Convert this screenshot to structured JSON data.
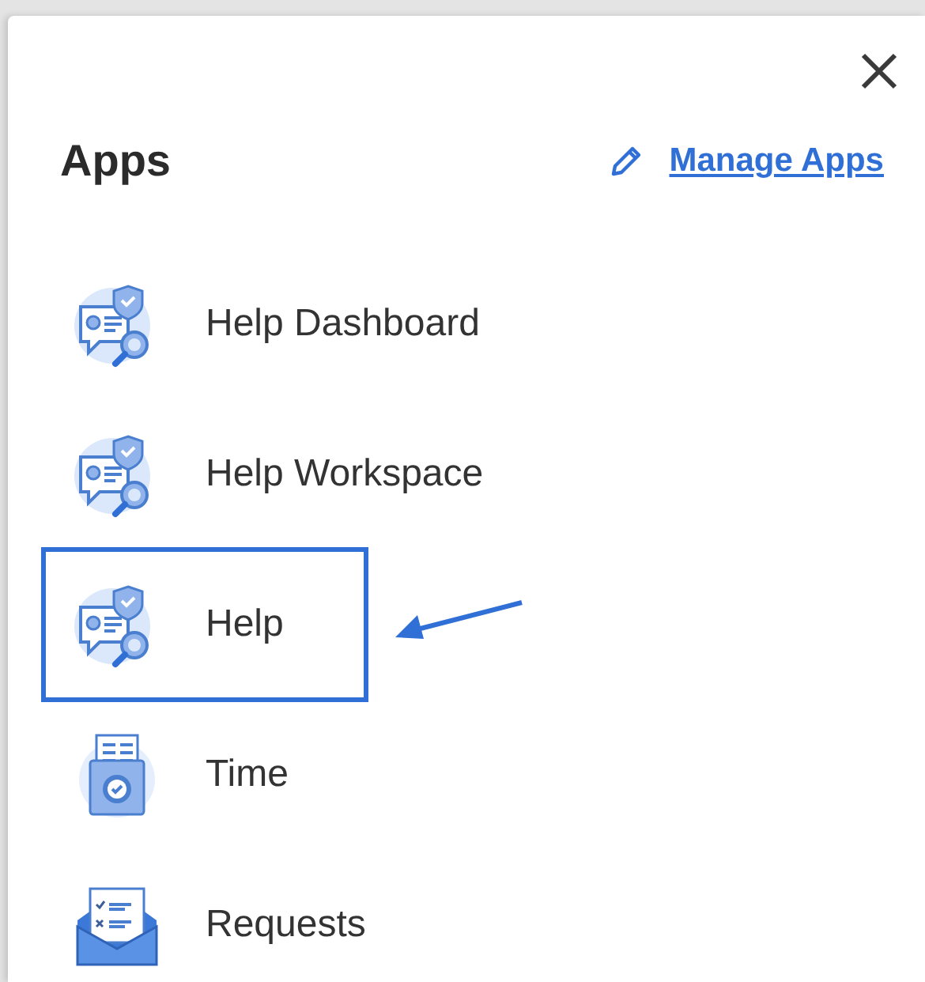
{
  "panel": {
    "title": "Apps",
    "manage_link": "Manage Apps"
  },
  "apps": [
    {
      "label": "Help Dashboard",
      "kind": "support",
      "selected": false
    },
    {
      "label": "Help Workspace",
      "kind": "support",
      "selected": false
    },
    {
      "label": "Help",
      "kind": "support",
      "selected": true
    },
    {
      "label": "Time",
      "kind": "timecard",
      "selected": false
    },
    {
      "label": "Requests",
      "kind": "envelope",
      "selected": false
    }
  ]
}
